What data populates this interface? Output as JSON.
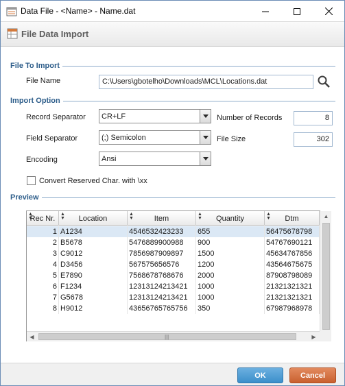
{
  "window": {
    "title": "Data File - <Name> - Name.dat"
  },
  "header": {
    "title": "File Data Import"
  },
  "file_to_import": {
    "section_label": "File To Import",
    "file_name_label": "File Name",
    "file_name_value": "C:\\Users\\gbotelho\\Downloads\\MCL\\Locations.dat"
  },
  "import_option": {
    "section_label": "Import Option",
    "record_separator_label": "Record Separator",
    "record_separator_value": "CR+LF",
    "field_separator_label": "Field Separator",
    "field_separator_value": "(;) Semicolon",
    "encoding_label": "Encoding",
    "encoding_value": "Ansi",
    "number_of_records_label": "Number of Records",
    "number_of_records_value": "8",
    "file_size_label": "File Size",
    "file_size_value": "302",
    "convert_label": "Convert Reserved Char. with \\xx",
    "convert_checked": false
  },
  "preview": {
    "section_label": "Preview",
    "columns": [
      "Rec Nr.",
      "Location",
      "Item",
      "Quantity",
      "Dtm"
    ],
    "rows": [
      [
        "1",
        "A1234",
        "4546532423233",
        "655",
        "56475678798"
      ],
      [
        "2",
        "B5678",
        "5476889900988",
        "900",
        "54767690121"
      ],
      [
        "3",
        "C9012",
        "7856987909897",
        "1500",
        "45634767856"
      ],
      [
        "4",
        "D3456",
        "567575656576",
        "1200",
        "43564675675"
      ],
      [
        "5",
        "E7890",
        "7568678768676",
        "2000",
        "87908798089"
      ],
      [
        "6",
        "F1234",
        "12313124213421",
        "1000",
        "21321321321"
      ],
      [
        "7",
        "G5678",
        "12313124213421",
        "1000",
        "21321321321"
      ],
      [
        "8",
        "H9012",
        "43656765765756",
        "350",
        "67987968978"
      ]
    ],
    "selected_row": 0
  },
  "footer": {
    "ok_label": "OK",
    "cancel_label": "Cancel"
  },
  "colors": {
    "section_label": "#2d5d8a",
    "ok_button": "#3b8fcb",
    "cancel_button": "#c9602f",
    "selected_row": "#dbe8f5"
  }
}
